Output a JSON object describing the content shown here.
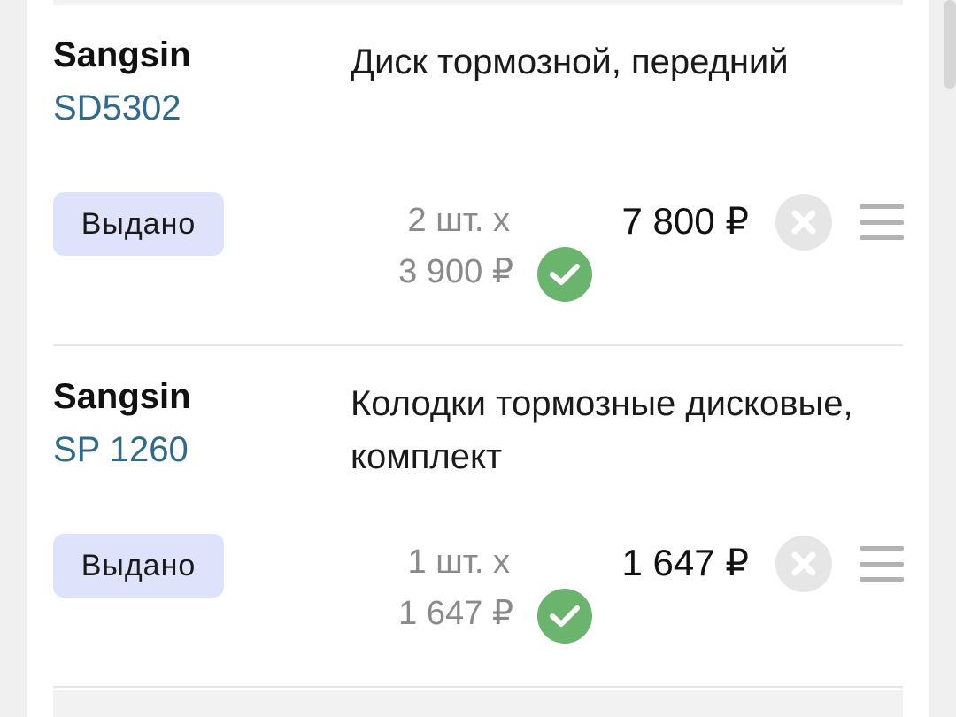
{
  "items": [
    {
      "brand": "Sangsin",
      "code": "SD5302",
      "description": "Диск тормозной, передний",
      "status": "Выдано",
      "quantity": "2 шт. x",
      "unit_price": "3 900 ₽",
      "total": "7 800 ₽",
      "confirmed_icon": "check-circle-icon",
      "remove_icon": "close-circle-icon",
      "menu_icon": "menu-icon"
    },
    {
      "brand": "Sangsin",
      "code": "SP 1260",
      "description": "Колодки тормозные дисковые, комплект",
      "status": "Выдано",
      "quantity": "1 шт. x",
      "unit_price": "1 647 ₽",
      "total": "1 647 ₽",
      "confirmed_icon": "check-circle-icon",
      "remove_icon": "close-circle-icon",
      "menu_icon": "menu-icon"
    }
  ],
  "colors": {
    "code_link": "#2f6a8a",
    "status_badge_bg": "#dfe2fb",
    "check_green": "#6ab46e",
    "remove_gray": "#e6e6e6",
    "muted_text": "#8a8a8a"
  }
}
